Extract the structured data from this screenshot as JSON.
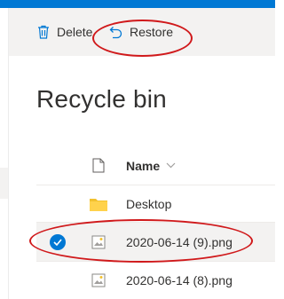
{
  "toolbar": {
    "delete_label": "Delete",
    "restore_label": "Restore"
  },
  "page": {
    "title": "Recycle bin"
  },
  "list": {
    "columns": {
      "name": "Name"
    },
    "rows": [
      {
        "name": "Desktop",
        "type": "folder-icon",
        "selected": false
      },
      {
        "name": "2020-06-14 (9).png",
        "type": "image-file-icon",
        "selected": true
      },
      {
        "name": "2020-06-14 (8).png",
        "type": "image-file-icon",
        "selected": false
      }
    ]
  },
  "colors": {
    "accent": "#0078d4",
    "annotation": "#d0191b",
    "folder": "#f2c12e"
  }
}
